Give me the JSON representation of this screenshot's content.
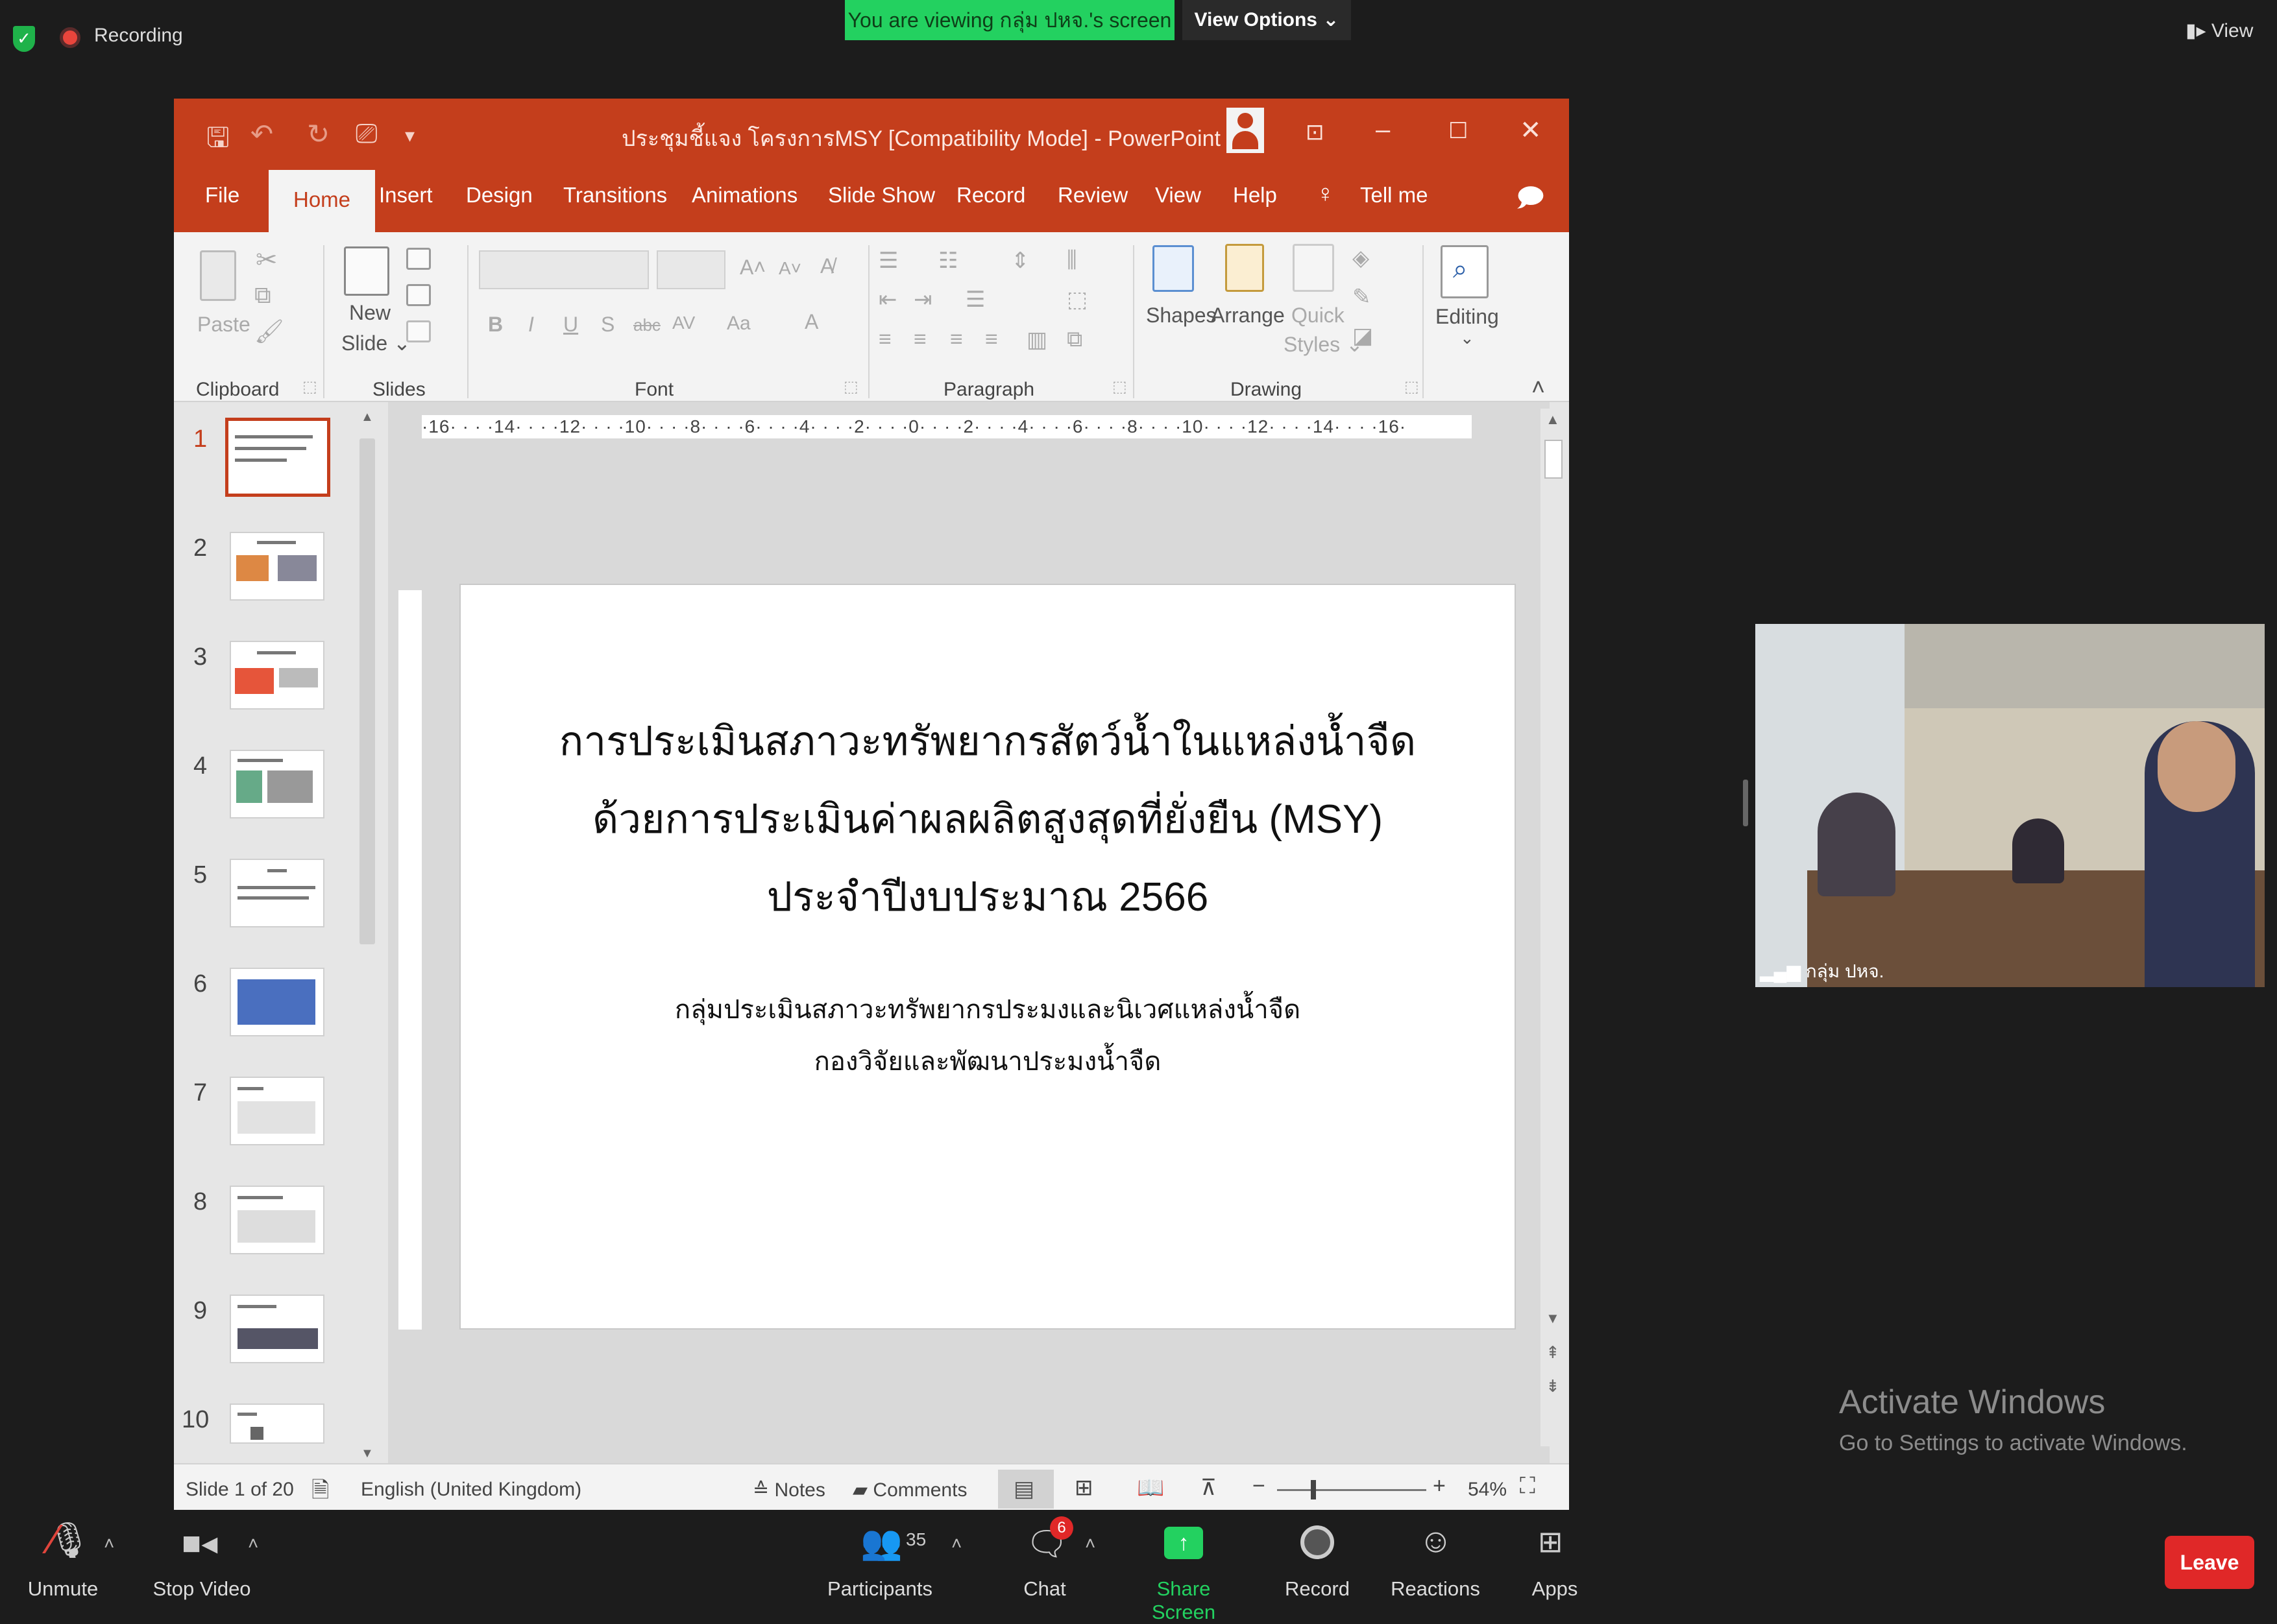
{
  "zoom": {
    "recording_label": "Recording",
    "viewing_banner": "You are viewing กลุ่ม ปหจ.'s screen",
    "view_options": "View Options ⌄",
    "view_button": "View",
    "participant_label": "กลุ่ม ปหจ.",
    "activate_windows_title": "Activate Windows",
    "activate_windows_sub": "Go to Settings to activate Windows.",
    "toolbar": {
      "unmute": "Unmute",
      "stop_video": "Stop Video",
      "participants": "Participants",
      "participants_count": "35",
      "chat": "Chat",
      "chat_badge": "6",
      "share_screen": "Share Screen",
      "record": "Record",
      "reactions": "Reactions",
      "apps": "Apps",
      "leave": "Leave"
    }
  },
  "ppt": {
    "window_title": "ประชุมชี้แจง โครงการMSY [Compatibility Mode] - PowerPoint",
    "tabs": [
      "File",
      "Home",
      "Insert",
      "Design",
      "Transitions",
      "Animations",
      "Slide Show",
      "Record",
      "Review",
      "View",
      "Help",
      "Tell me"
    ],
    "ribbon": {
      "paste": "Paste",
      "new_slide_1": "New",
      "new_slide_2": "Slide ⌄",
      "shapes": "Shapes",
      "arrange": "Arrange",
      "quick": "Quick",
      "styles": "Styles ⌄",
      "editing": "Editing",
      "groups": [
        "Clipboard",
        "Slides",
        "Font",
        "Paragraph",
        "Drawing"
      ]
    },
    "ruler_text": "·16· · · ·14· · · ·12· · · ·10· · · ·8· · · ·6· · · ·4· · · ·2· · · ·0· · · ·2· · · ·4· · · ·6· · · ·8· · · ·10· · · ·12· · · ·14· · · ·16·",
    "slide_numbers": [
      "1",
      "2",
      "3",
      "4",
      "5",
      "6",
      "7",
      "8",
      "9",
      "10"
    ],
    "slide": {
      "title_line1": "การประเมินสภาวะทรัพยากรสัตว์น้ำในแหล่งน้ำจืด",
      "title_line2": "ด้วยการประเมินค่าผลผลิตสูงสุดที่ยั่งยืน (MSY)",
      "title_line3": "ประจำปีงบประมาณ 2566",
      "sub_line1": "กลุ่มประเมินสภาวะทรัพยากรประมงและนิเวศแหล่งน้ำจืด",
      "sub_line2": "กองวิจัยและพัฒนาประมงน้ำจืด"
    },
    "status": {
      "slide_info": "Slide 1 of 20",
      "language": "English (United Kingdom)",
      "notes": "Notes",
      "comments": "Comments",
      "zoom_level": "54%"
    }
  },
  "colors": {
    "ppt_accent": "#c43e1c",
    "zoom_green": "#23d160",
    "leave_red": "#e02828"
  }
}
